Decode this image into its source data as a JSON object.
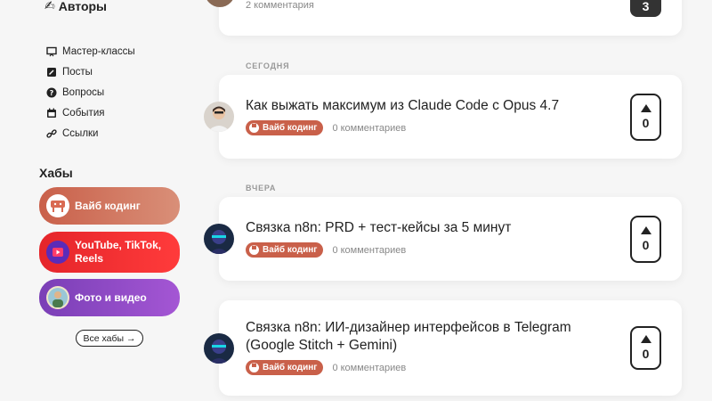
{
  "sidebar": {
    "authors_label": "Авторы",
    "menu": [
      {
        "label": "Мастер-классы",
        "icon": "presentation-icon"
      },
      {
        "label": "Посты",
        "icon": "edit-icon"
      },
      {
        "label": "Вопросы",
        "icon": "question-icon"
      },
      {
        "label": "События",
        "icon": "calendar-icon"
      },
      {
        "label": "Ссылки",
        "icon": "link-icon"
      }
    ],
    "hubs_title": "Хабы",
    "hubs": [
      {
        "label": "Вайб кодинг",
        "color": "#c9604a"
      },
      {
        "label_line1": "YouTube, TikTok,",
        "label_line2": "Reels",
        "color": "#ff2d2d"
      },
      {
        "label": "Фото и видео",
        "color": "#8e47c4"
      }
    ],
    "all_hubs": "Все хабы →"
  },
  "feed": {
    "top_post": {
      "comments": "2 комментария",
      "votes": "3"
    },
    "sections": {
      "today": "СЕГОДНЯ",
      "yesterday": "ВЧЕРА"
    },
    "posts": [
      {
        "title": "Как выжать максимум из Claude Code с Opus 4.7",
        "tag": "Вайб кодинг",
        "comments": "0 комментариев",
        "votes": "0"
      },
      {
        "title": "Связка n8n: PRD + тест-кейсы за 5 минут",
        "tag": "Вайб кодинг",
        "comments": "0 комментариев",
        "votes": "0"
      },
      {
        "title": "Связка n8n: ИИ-дизайнер интерфейсов в Telegram (Google Stitch + Gemini)",
        "tag": "Вайб кодинг",
        "comments": "0 комментариев",
        "votes": "0"
      }
    ]
  },
  "colors": {
    "accent": "#c9604a",
    "dark": "#222222",
    "muted": "#888888"
  }
}
